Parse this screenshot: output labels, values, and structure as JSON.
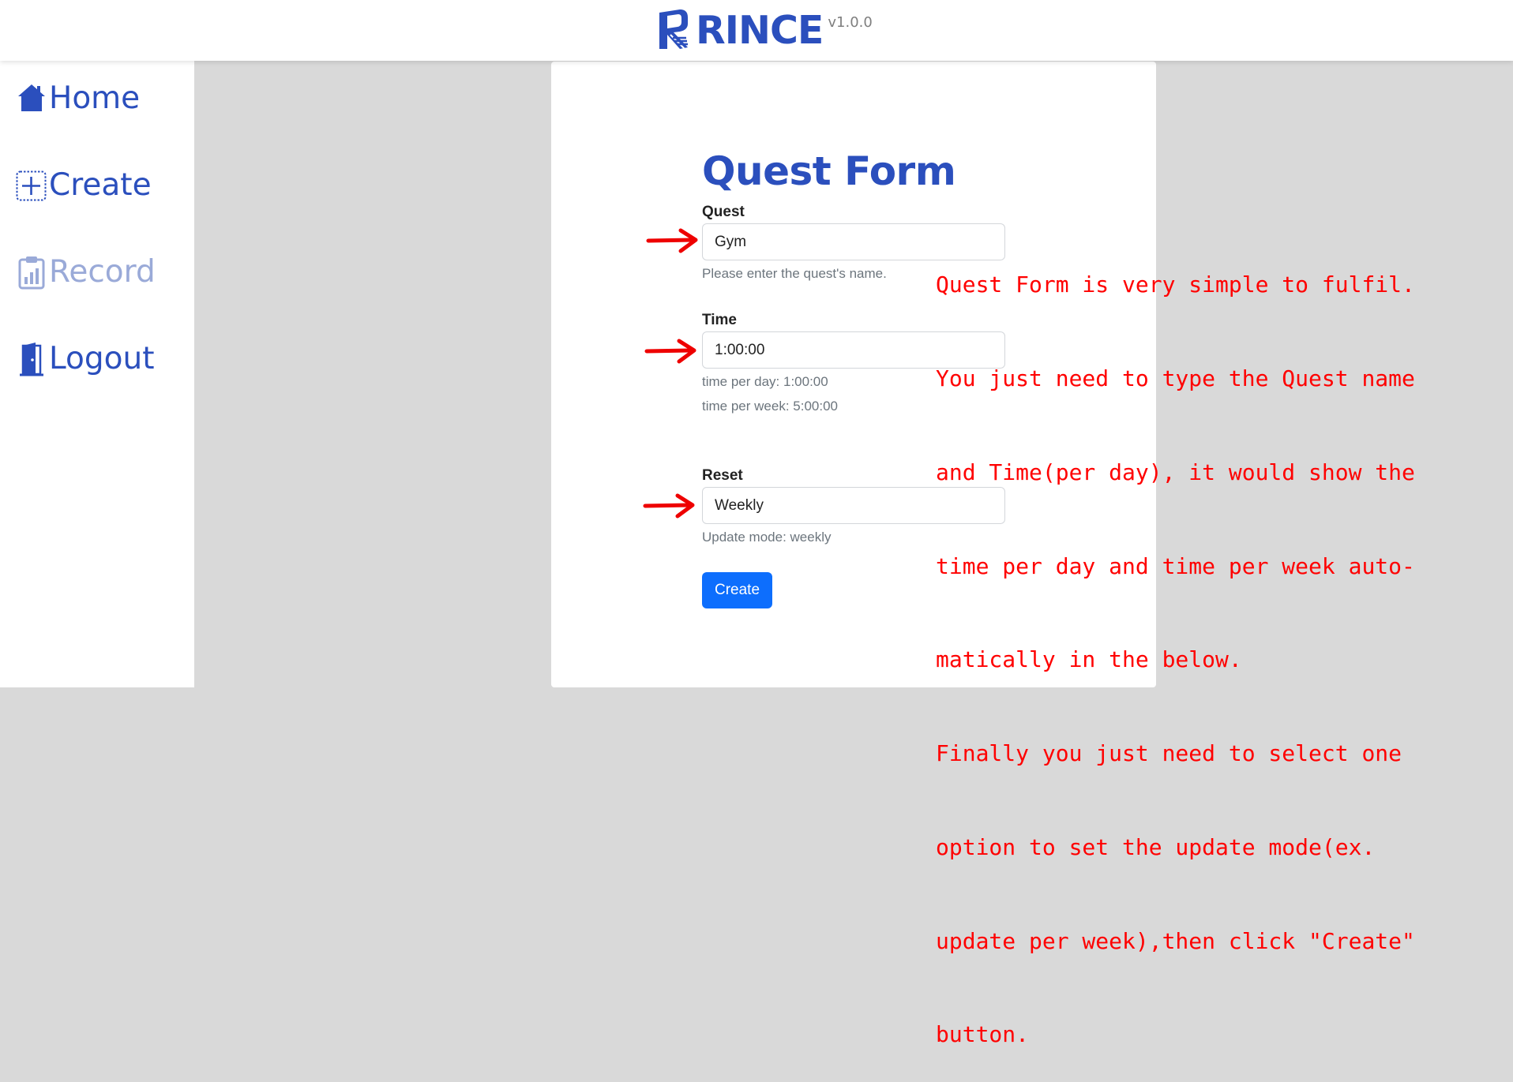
{
  "header": {
    "app_name": "RINCE",
    "version": "v1.0.0",
    "logo_icon": "rince-logo-icon"
  },
  "sidebar": {
    "items": [
      {
        "label": "Home",
        "icon": "home-icon",
        "enabled": true
      },
      {
        "label": "Create",
        "icon": "plus-square-icon",
        "enabled": true
      },
      {
        "label": "Record",
        "icon": "clipboard-chart-icon",
        "enabled": false
      },
      {
        "label": "Logout",
        "icon": "door-exit-icon",
        "enabled": true
      }
    ]
  },
  "form": {
    "title": "Quest Form",
    "quest": {
      "label": "Quest",
      "value": "Gym",
      "help": "Please enter the quest's name."
    },
    "time": {
      "label": "Time",
      "value": "1:00:00",
      "per_day": "time per day: 1:00:00",
      "per_week": "time per week: 5:00:00"
    },
    "reset": {
      "label": "Reset",
      "value": "Weekly",
      "help": "Update mode: weekly"
    },
    "submit_label": "Create"
  },
  "annotation": {
    "lines": [
      "Quest Form is very simple to fulfil.",
      "You just need to type the Quest name",
      "and Time(per day), it would show the",
      "time per day and time per week auto-",
      "matically in the below.",
      "Finally you just need to select one",
      "option to set the update mode(ex.",
      "update per week),then click \"Create\"",
      "button."
    ]
  },
  "colors": {
    "brand": "#2b4fbd",
    "brand_disabled": "#9aaad8",
    "primary_button": "#0d6efd",
    "annotation": "#ff0000",
    "background": "#d9d9d9"
  }
}
